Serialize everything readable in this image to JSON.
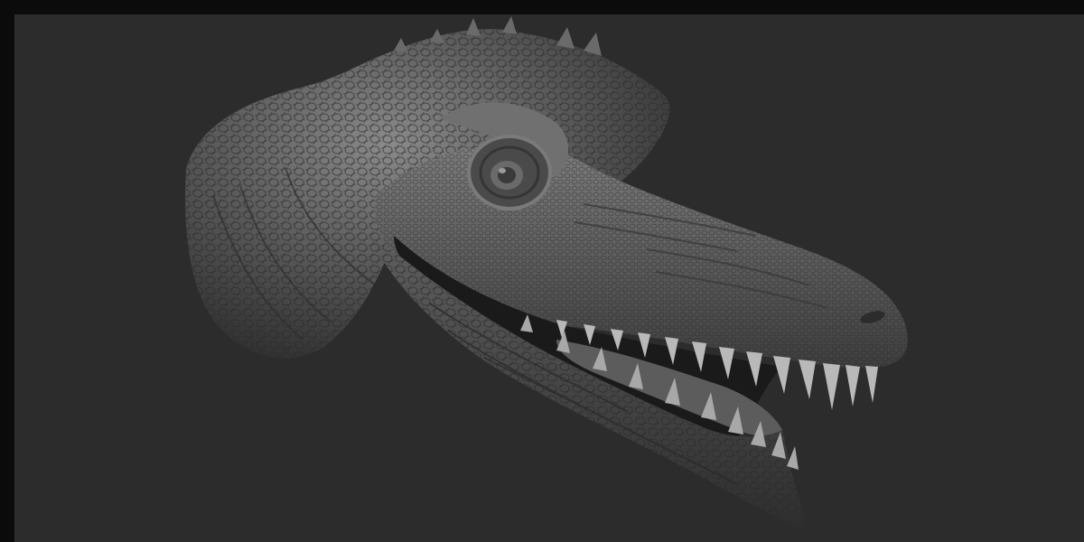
{
  "scene": {
    "subject": "dinosaur-head-sculpt",
    "colors": {
      "frame": "#0b0b0b",
      "background": "#2c2c2c",
      "clay_dark": "#3a3a3a",
      "clay_mid": "#5a5a5a",
      "clay_light": "#8a8a8a",
      "mouth_dark": "#1a1a1a",
      "tooth": "#b9b9b9"
    }
  }
}
